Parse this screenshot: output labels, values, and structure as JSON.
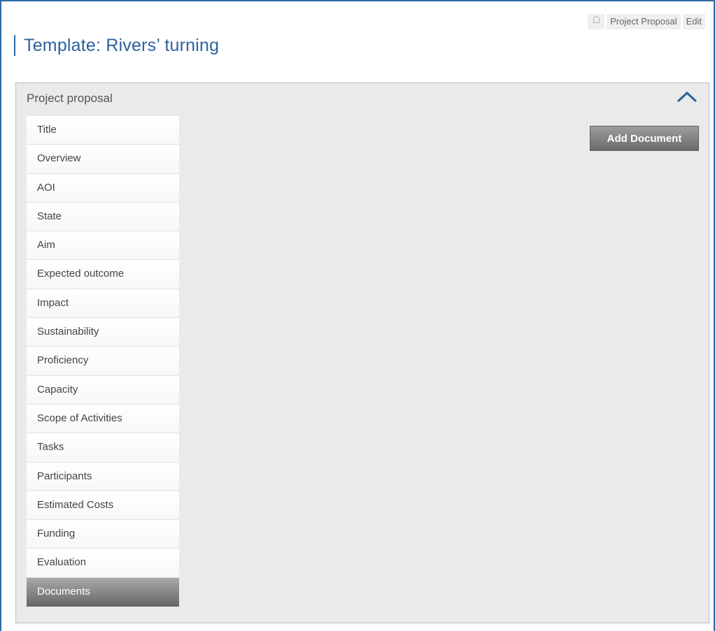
{
  "header": {
    "breadcrumb_label": "Project Proposal",
    "edit_label": "Edit",
    "page_title": "Template: Rivers’ turning",
    "bell_icon": "bell-icon"
  },
  "panel": {
    "title": "Project proposal",
    "collapse_icon": "chevron-up-icon",
    "add_document_label": "Add Document",
    "menu_items": [
      {
        "label": "Title"
      },
      {
        "label": "Overview"
      },
      {
        "label": "AOI"
      },
      {
        "label": "State"
      },
      {
        "label": "Aim"
      },
      {
        "label": "Expected outcome"
      },
      {
        "label": "Impact"
      },
      {
        "label": "Sustainability"
      },
      {
        "label": "Proficiency"
      },
      {
        "label": "Capacity"
      },
      {
        "label": "Scope of Activities"
      },
      {
        "label": "Tasks"
      },
      {
        "label": "Participants"
      },
      {
        "label": "Estimated Costs"
      },
      {
        "label": "Funding"
      },
      {
        "label": "Evaluation"
      },
      {
        "label": "Documents",
        "active": true
      }
    ]
  },
  "colors": {
    "accent": "#2e6aa8",
    "title": "#2c62a0",
    "panel_bg": "#eaeaea",
    "active_item": "#7a7a7a"
  }
}
